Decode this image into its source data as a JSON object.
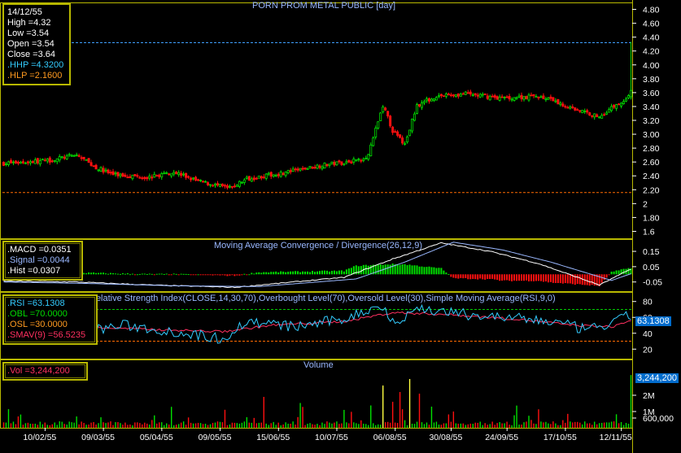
{
  "chart_data": {
    "type": "candlestick",
    "title": "PORN PROM METAL PUBLIC [day]",
    "x_tick_labels": [
      "10/02/55",
      "09/03/55",
      "05/04/55",
      "09/05/55",
      "15/06/55",
      "10/07/55",
      "06/08/55",
      "30/08/55",
      "24/09/55",
      "17/10/55",
      "12/11/55"
    ],
    "price_axis": {
      "ticks": [
        "4.80",
        "4.60",
        "4.40",
        "4.20",
        "4.00",
        "3.80",
        "3.60",
        "3.40",
        "3.20",
        "3.00",
        "2.80",
        "2.60",
        "2.40",
        "2.20",
        "2",
        "1.80",
        "1.6"
      ],
      "ylim": [
        1.5,
        4.9
      ]
    },
    "hhp": 4.32,
    "hlp": 2.16,
    "price_anchors": [
      [
        0,
        2.58
      ],
      [
        18,
        2.62
      ],
      [
        30,
        2.7
      ],
      [
        38,
        2.52
      ],
      [
        45,
        2.42
      ],
      [
        60,
        2.38
      ],
      [
        70,
        2.46
      ],
      [
        80,
        2.32
      ],
      [
        93,
        2.22
      ],
      [
        100,
        2.36
      ],
      [
        115,
        2.44
      ],
      [
        130,
        2.55
      ],
      [
        145,
        2.62
      ],
      [
        150,
        2.7
      ],
      [
        156,
        3.42
      ],
      [
        160,
        3.05
      ],
      [
        165,
        2.85
      ],
      [
        170,
        3.42
      ],
      [
        178,
        3.55
      ],
      [
        190,
        3.58
      ],
      [
        205,
        3.52
      ],
      [
        220,
        3.55
      ],
      [
        232,
        3.4
      ],
      [
        245,
        3.25
      ],
      [
        250,
        3.38
      ],
      [
        254,
        3.46
      ],
      [
        256,
        3.5
      ],
      [
        258,
        3.64
      ]
    ],
    "macd": {
      "title": "Moving Average Convergence / Divergence(26,12,9)",
      "ticks": [
        "0.15",
        "0.05",
        "-0.05"
      ],
      "ylim": [
        -0.11,
        0.23
      ],
      "macd_anchors": [
        [
          0,
          -0.045
        ],
        [
          30,
          -0.05
        ],
        [
          60,
          -0.07
        ],
        [
          95,
          -0.085
        ],
        [
          140,
          -0.02
        ],
        [
          160,
          0.1
        ],
        [
          180,
          0.205
        ],
        [
          200,
          0.15
        ],
        [
          220,
          0.07
        ],
        [
          245,
          -0.07
        ],
        [
          258,
          0.035
        ]
      ],
      "signal_anchors": [
        [
          0,
          -0.05
        ],
        [
          35,
          -0.06
        ],
        [
          70,
          -0.075
        ],
        [
          105,
          -0.08
        ],
        [
          145,
          -0.03
        ],
        [
          165,
          0.08
        ],
        [
          185,
          0.21
        ],
        [
          205,
          0.16
        ],
        [
          225,
          0.08
        ],
        [
          250,
          -0.04
        ],
        [
          258,
          0.004
        ]
      ]
    },
    "rsi": {
      "title": "Relative Strength Index(CLOSE,14,30,70),Overbought Level(70),Oversold Level(30),Simple Moving Average(RSI,9,0)",
      "ticks": [
        "80",
        "60",
        "40",
        "20"
      ],
      "ylim": [
        8,
        92
      ],
      "overbought": 70,
      "oversold": 30,
      "rsi_anchors": [
        [
          0,
          48
        ],
        [
          20,
          52
        ],
        [
          35,
          44
        ],
        [
          50,
          50
        ],
        [
          70,
          42
        ],
        [
          90,
          33
        ],
        [
          100,
          55
        ],
        [
          120,
          48
        ],
        [
          140,
          58
        ],
        [
          155,
          75
        ],
        [
          162,
          52
        ],
        [
          170,
          72
        ],
        [
          185,
          65
        ],
        [
          205,
          60
        ],
        [
          225,
          55
        ],
        [
          240,
          44
        ],
        [
          250,
          52
        ],
        [
          258,
          63
        ]
      ],
      "smav_anchors": [
        [
          0,
          47
        ],
        [
          30,
          48
        ],
        [
          60,
          45
        ],
        [
          90,
          42
        ],
        [
          110,
          50
        ],
        [
          140,
          55
        ],
        [
          160,
          66
        ],
        [
          180,
          64
        ],
        [
          210,
          58
        ],
        [
          235,
          50
        ],
        [
          250,
          48
        ],
        [
          258,
          56
        ]
      ]
    },
    "volume": {
      "title": "Volume",
      "ticks": [
        "2M",
        "1M",
        "600,000"
      ],
      "ymax": 4000000
    }
  },
  "info": {
    "date": "14/12/55",
    "high": "High  =4.32",
    "low": "Low   =3.54",
    "open": "Open  =3.54",
    "close": "Close =3.64",
    "hhp": ".HHP   =4.3200",
    "hlp": ".HLP   =2.1600"
  },
  "macd_info": {
    "macd": ".MACD =0.0351",
    "signal": ".Signal =0.0044",
    "hist": ".Hist  =0.0307"
  },
  "rsi_info": {
    "rsi": ".RSI    =63.1308",
    "obl": ".OBL    =70.0000",
    "osl": ".OSL    =30.0000",
    "smav": ".SMAV(9)  =56.5235",
    "last": "63.1308"
  },
  "vol_info": {
    "vol": ".Vol  =3,244,200",
    "last": "3,244,200"
  },
  "colors": {
    "up": "#00e000",
    "down": "#ff1010",
    "hhp_line": "#3fa0ff",
    "hlp_line": "#ff6a00",
    "border": "#b8b800",
    "macd_line": "#ffffff",
    "signal_line": "#9ab8ff",
    "rsi_line": "#33ccff",
    "smav_line": "#ff3060",
    "ob_line": "#00cc00",
    "os_line": "#ff6a00",
    "hhp_text": "#33ccff",
    "hlp_text": "#ff9a20",
    "vol_text": "#ff3060"
  }
}
